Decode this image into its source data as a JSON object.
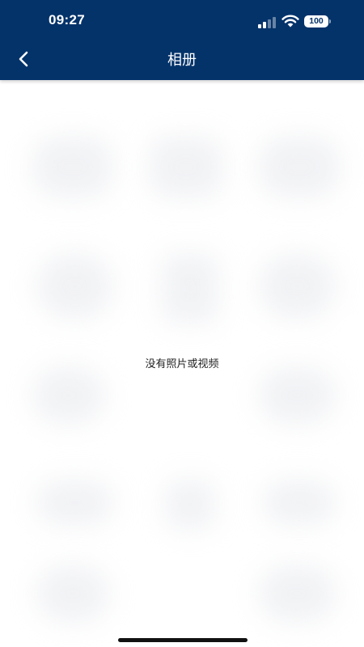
{
  "status_bar": {
    "time": "09:27",
    "battery": "100",
    "icons": [
      "signal-icon",
      "wifi-icon",
      "battery-icon"
    ]
  },
  "nav": {
    "title": "相册",
    "back_icon": "chevron-left-icon"
  },
  "empty_state": {
    "message": "没有照片或视频"
  },
  "colors": {
    "header_background": "#04336a",
    "header_text": "#ffffff",
    "page_background": "#ffffff",
    "message_text": "#222222"
  }
}
